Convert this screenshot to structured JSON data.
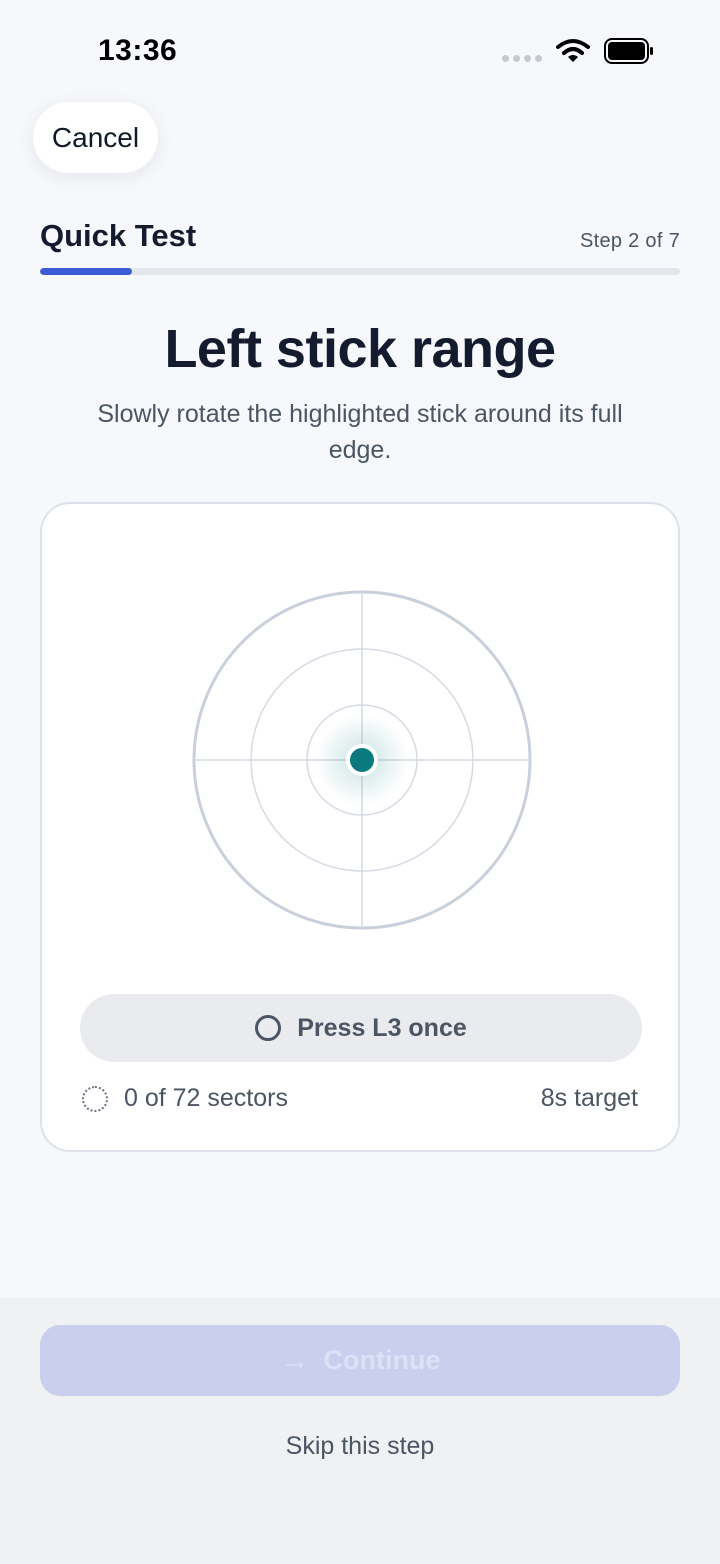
{
  "status_bar": {
    "time": "13:36"
  },
  "header": {
    "cancel_label": "Cancel",
    "test_title": "Quick Test",
    "step_label": "Step 2 of 7",
    "progress": 0.143
  },
  "main": {
    "title": "Left stick range",
    "subtitle": "Slowly rotate the highlighted stick around its full edge."
  },
  "card": {
    "press_label": "Press L3 once",
    "sectors_label": "0 of 72 sectors",
    "target_label": "8s target"
  },
  "footer": {
    "continue_label": "Continue",
    "skip_label": "Skip this step"
  },
  "colors": {
    "accent": "#3e5bd6",
    "stick_dot": "#0b7a80",
    "disabled_button": "#c9cfed"
  },
  "icons": {
    "signal": "cellular-signal-icon",
    "wifi": "wifi-icon",
    "battery": "battery-icon",
    "press": "ring-icon",
    "sectors": "dotted-ring-icon",
    "continue": "arrow-right-icon"
  }
}
